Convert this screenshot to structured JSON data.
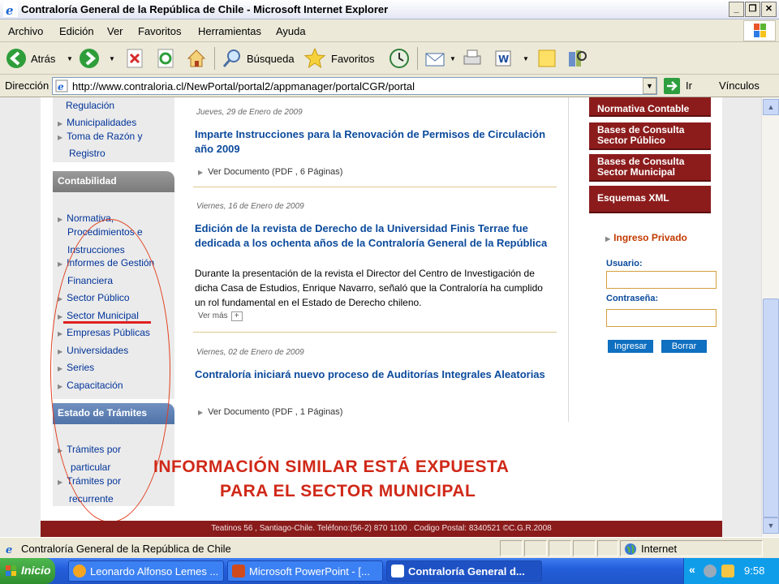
{
  "window": {
    "title": "Contraloría General de la República de Chile - Microsoft Internet Explorer",
    "minimize": "_",
    "maximize": "❐",
    "close": "✕"
  },
  "menu": [
    "Archivo",
    "Edición",
    "Ver",
    "Favoritos",
    "Herramientas",
    "Ayuda"
  ],
  "toolbar": {
    "back": "Atrás",
    "search": "Búsqueda",
    "favorites": "Favoritos"
  },
  "address": {
    "label": "Dirección",
    "url": "http://www.contraloria.cl/NewPortal/portal2/appmanager/portalCGR/portal",
    "go": "Ir",
    "links": "Vínculos"
  },
  "leftnav": {
    "top_items": [
      "Regulación",
      "Municipalidades",
      "Toma de Razón y",
      "Registro"
    ],
    "contabilidad_title": "Contabilidad",
    "contabilidad_items": [
      "Normativa,",
      "Procedimientos e",
      "Instrucciones",
      "Informes de Gestión",
      "Financiera",
      "Sector Público",
      "Sector Municipal",
      "Empresas Públicas",
      "Universidades",
      "Series",
      "Capacitación"
    ],
    "tramites_title": "Estado de Trámites",
    "tramites_items": [
      "Trámites por",
      "particular",
      "Trámites por",
      "recurrente"
    ]
  },
  "news": [
    {
      "date": "Jueves, 29 de Enero de 2009",
      "title": "Imparte Instrucciones para la Renovación de Permisos de Circulación año 2009",
      "doc_link": "Ver Documento",
      "doc_meta": "(PDF , 6 Páginas)"
    },
    {
      "date": "Viernes, 16 de Enero de 2009",
      "title": "Edición de la revista de Derecho de la Universidad Finis Terrae fue dedicada a los ochenta años de la Contraloría General de la República",
      "body": "Durante la presentación de la revista el Director del Centro de Investigación de dicha Casa de Estudios, Enrique Navarro, señaló que la Contraloría ha cumplido un rol fundamental en el Estado de Derecho chileno.",
      "more": "Ver más",
      "more_plus": "+"
    },
    {
      "date": "Viernes, 02 de Enero de 2009",
      "title": "Contraloría iniciará nuevo proceso de Auditorías Integrales Aleatorias",
      "doc_link": "Ver Documento",
      "doc_meta": "(PDF , 1 Páginas)"
    }
  ],
  "right": {
    "buttons": [
      "Base de Datos\nNormativa Contable",
      "Bases de Consulta\nSector Público",
      "Bases de Consulta\nSector Municipal",
      "Esquemas XML"
    ],
    "login_title": "Ingreso Privado",
    "user_label": "Usuario:",
    "password_label": "Contraseña:",
    "submit": "Ingresar",
    "clear": "Borrar"
  },
  "overlay": {
    "line1": "INFORMACIÓN SIMILAR ESTÁ EXPUESTA",
    "line2": "PARA EL SECTOR MUNICIPAL"
  },
  "footer": "Teatinos 56 , Santiago-Chile. Teléfono:(56-2) 870 1100 . Codigo Postal: 8340521 ©C.G.R.2008",
  "status": {
    "text": "Contraloría General de la República de Chile",
    "zone": "Internet"
  },
  "taskbar": {
    "start": "Inicio",
    "tasks": [
      "Leonardo Alfonso Lemes ...",
      "Microsoft PowerPoint - [...",
      "Contraloría General d..."
    ],
    "tray_chevron": "«",
    "clock": "9:58"
  },
  "colors": {
    "link_blue": "#0b4a9c",
    "brand_red": "#8c1c1c",
    "annotation_red": "#d02818"
  }
}
